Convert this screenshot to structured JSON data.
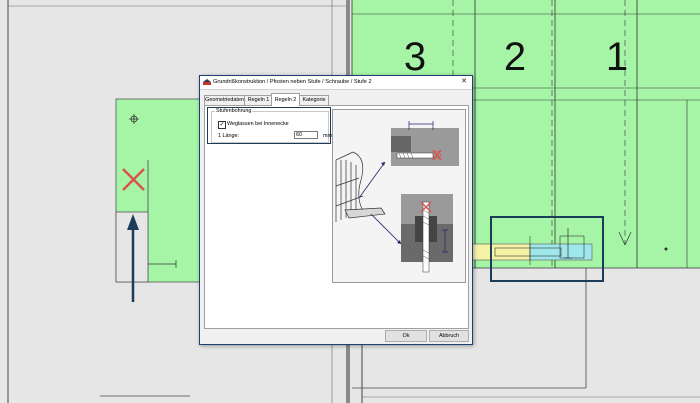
{
  "drawing": {
    "step_numbers": [
      "3",
      "2",
      "1"
    ],
    "colors": {
      "workspace": "#e6e6e6",
      "stair_green": "#a6f5a6",
      "highlight_frame": "#1c3d5a",
      "red_marker": "#d9534f",
      "beam_yellow": "#f6f2a6",
      "beam_cyan": "#9ee8ec"
    },
    "icons": [
      "crosshair-icon",
      "delete-cross-icon",
      "direction-arrow-icon"
    ]
  },
  "dialog": {
    "title": "Grundrißkonstruktion / Pfosten neben Stufe / Schraube / Stufe 2",
    "close_icon": "✕",
    "tabs": [
      {
        "label": "Geometriedaten",
        "active": false
      },
      {
        "label": "Regeln 1",
        "active": false
      },
      {
        "label": "Regeln 2",
        "active": true
      },
      {
        "label": "Kategorie",
        "active": false
      }
    ],
    "group": {
      "title": "Stufenbohrung",
      "checkbox_label": "Weglassen bei Innenecke",
      "checkbox_checked": true,
      "checkbox_mark": "✓",
      "length_label": "1 Länge:",
      "length_value": "60",
      "length_unit": "mm"
    },
    "ok_label": "Ok",
    "cancel_label": "Abbruch"
  }
}
